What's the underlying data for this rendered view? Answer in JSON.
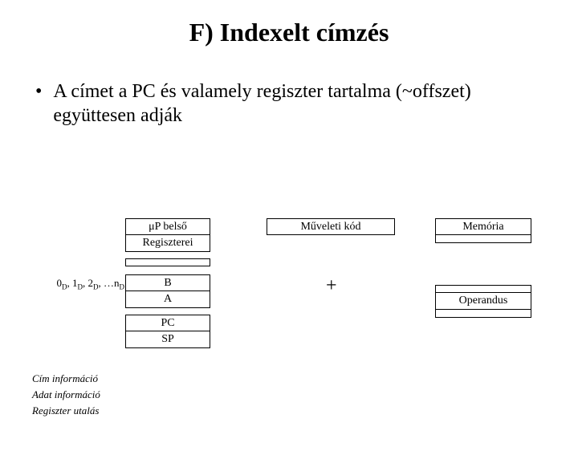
{
  "title": "F) Indexelt címzés",
  "bullet": "A címet a PC és valamely regiszter tartalma (~offszet) együttesen adják",
  "diagram": {
    "registers": {
      "up_header": "μP belső",
      "regiszterei": "Regiszterei",
      "b": "B",
      "a": "A",
      "pc": "PC",
      "sp": "SP"
    },
    "databus_prefix": "0",
    "databus_items": ", 1",
    "databus_item2": ", 2",
    "databus_tail": ", …n",
    "databus_sub": "D",
    "opcode": "Műveleti kód",
    "plus": "+",
    "memory_header": "Memória",
    "memory_operand": "Operandus"
  },
  "legend": {
    "cim": "Cím információ",
    "adat": "Adat információ",
    "regiszter": "Regiszter utalás"
  }
}
